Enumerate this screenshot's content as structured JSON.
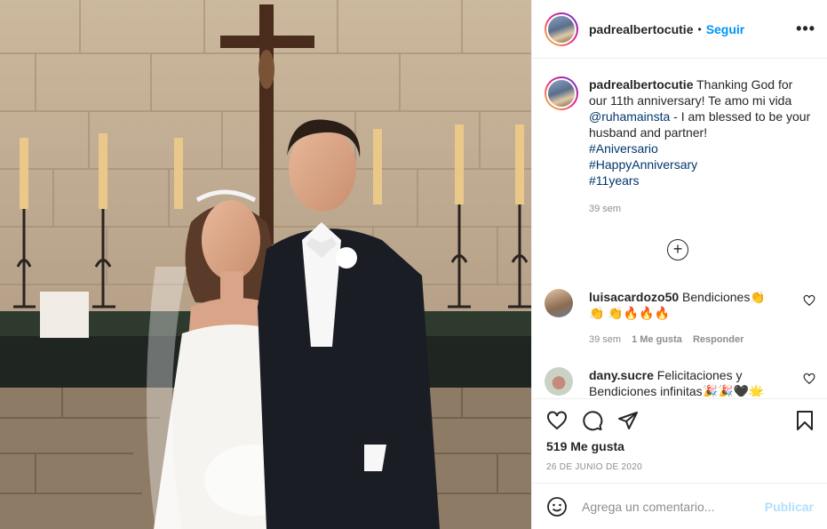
{
  "post": {
    "username": "padrealbertocutie",
    "separator": "•",
    "follow_label": "Seguir",
    "more_label": "•••"
  },
  "caption": {
    "username": "padrealbertocutie",
    "text_1": "Thanking God for our 11th anniversary! Te amo mi vida",
    "mention": "@ruhamainsta",
    "text_2": "- I am blessed to be your husband and partner!",
    "hashtags": [
      "#Aniversario",
      "#HappyAnniversary",
      "#11years"
    ],
    "time": "39 sem"
  },
  "load_more_label": "+",
  "comments": [
    {
      "username": "luisacardozo50",
      "text": "Bendiciones👏👏 👏🔥🔥🔥",
      "time": "39 sem",
      "likes": "1 Me gusta",
      "reply": "Responder"
    },
    {
      "username": "dany.sucre",
      "text": "Felicitaciones y Bendiciones infinitas🎉🎉🖤🌟"
    }
  ],
  "actions": {
    "likes_count": "519 Me gusta",
    "date": "26 DE JUNIO DE 2020"
  },
  "add_comment": {
    "placeholder": "Agrega un comentario...",
    "publish_label": "Publicar"
  },
  "colors": {
    "link": "#00376b",
    "accent": "#0095f6",
    "publish_disabled": "#b2dffc"
  }
}
